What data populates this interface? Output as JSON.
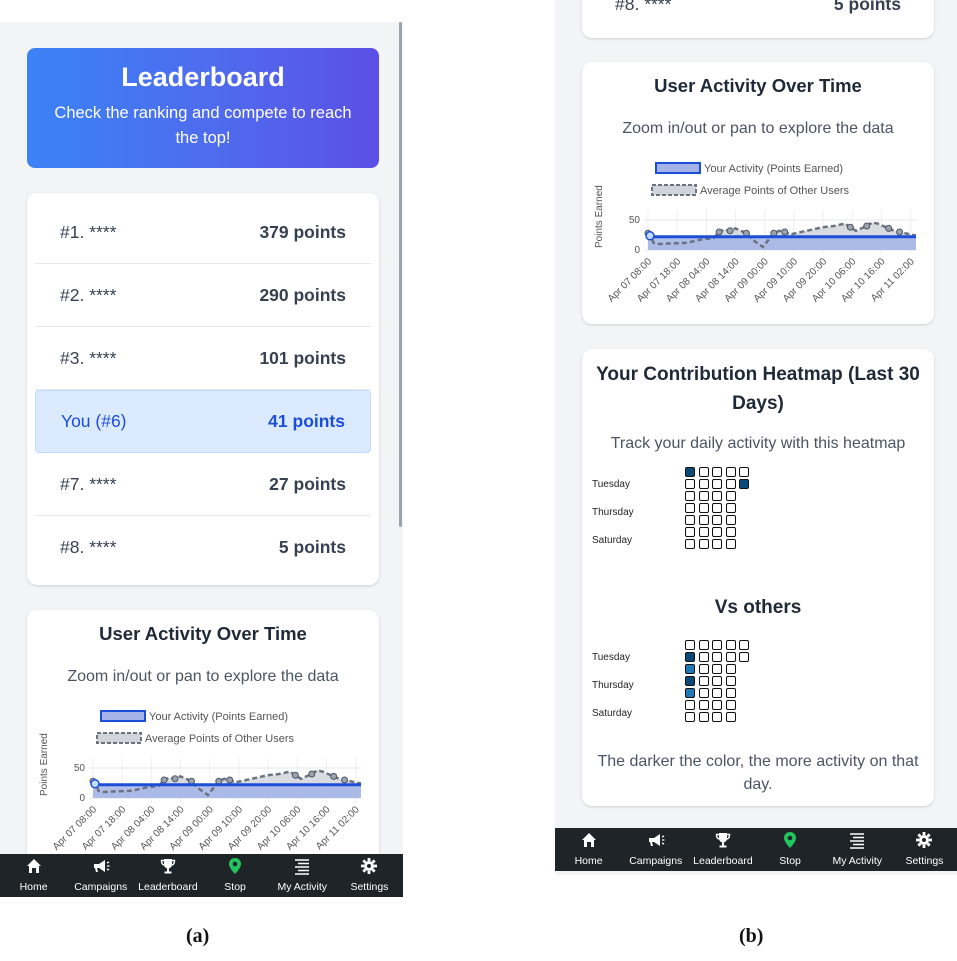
{
  "captions": {
    "a": "(a)",
    "b": "(b)"
  },
  "hero": {
    "title": "Leaderboard",
    "subtitle": "Check the ranking and compete to reach the top!"
  },
  "leaderboard": {
    "rows": [
      {
        "rank": "#1. ****",
        "points": "379 points",
        "is_user": false
      },
      {
        "rank": "#2. ****",
        "points": "290 points",
        "is_user": false
      },
      {
        "rank": "#3. ****",
        "points": "101 points",
        "is_user": false
      },
      {
        "rank": "You (#6)",
        "points": "41 points",
        "is_user": true
      },
      {
        "rank": "#7. ****",
        "points": "27 points",
        "is_user": false
      },
      {
        "rank": "#8. ****",
        "points": "5 points",
        "is_user": false
      }
    ]
  },
  "activity_card": {
    "title": "User Activity Over Time",
    "subtitle": "Zoom in/out or pan to explore the data"
  },
  "chart_data": {
    "type": "line",
    "ylabel": "Points Earned",
    "xlabel": "",
    "ylim": [
      0,
      60
    ],
    "yticks": [
      "0",
      "50"
    ],
    "x_tick_labels": [
      "Apr 07 08:00",
      "Apr 07 18:00",
      "Apr 08 04:00",
      "Apr 08 14:00",
      "Apr 09 00:00",
      "Apr 09 10:00",
      "Apr 09 20:00",
      "Apr 10 06:00",
      "Apr 10 16:00",
      "Apr 11 02:00"
    ],
    "legend_position": "top",
    "series": [
      {
        "name": "Your Activity (Points Earned)",
        "color": "#1d4ed8",
        "fill": "#a5b4e8",
        "x": [
          0,
          98
        ],
        "values": [
          22,
          22
        ]
      },
      {
        "name": "Average Points of Other Users",
        "color": "#6b7280",
        "fill": "#d1d5db",
        "dashed": true,
        "x": [
          0,
          1,
          2,
          4,
          8,
          14,
          16,
          20,
          24,
          26,
          28,
          30,
          32,
          36,
          38,
          42,
          46,
          48,
          50,
          52,
          56,
          60,
          64,
          68,
          70,
          72,
          74,
          76,
          80,
          82,
          84,
          86,
          88,
          90,
          92,
          94,
          96,
          98
        ],
        "values": [
          28,
          25,
          12,
          10,
          11,
          12,
          14,
          18,
          20,
          30,
          34,
          32,
          36,
          28,
          18,
          5,
          28,
          32,
          30,
          26,
          30,
          34,
          38,
          40,
          42,
          44,
          38,
          32,
          40,
          46,
          44,
          40,
          36,
          32,
          30,
          28,
          26,
          24
        ]
      }
    ]
  },
  "heatmap_card": {
    "title": "Your Contribution Heatmap (Last 30 Days)",
    "subtitle": "Track your daily activity with this heatmap",
    "day_labels": [
      "Tuesday",
      "Thursday",
      "Saturday"
    ],
    "vs_title": "Vs others",
    "note": "The darker the color, the more activity on that day."
  },
  "heatmap_data": {
    "yours": {
      "columns": [
        [
          2,
          0,
          0,
          0,
          0,
          0,
          0
        ],
        [
          0,
          0,
          0,
          0,
          0,
          0,
          0
        ],
        [
          0,
          0,
          0,
          0,
          0,
          0,
          0
        ],
        [
          0,
          0,
          0,
          0,
          0,
          0,
          0
        ],
        [
          0,
          2,
          -1,
          -1,
          -1,
          -1,
          -1
        ]
      ]
    },
    "others": {
      "columns": [
        [
          0,
          2,
          1,
          2,
          1,
          0,
          0
        ],
        [
          0,
          0,
          0,
          0,
          0,
          0,
          0
        ],
        [
          0,
          0,
          0,
          0,
          0,
          0,
          0
        ],
        [
          0,
          0,
          0,
          0,
          0,
          0,
          0
        ],
        [
          0,
          0,
          -1,
          -1,
          -1,
          -1,
          -1
        ]
      ]
    },
    "level_colors": [
      "#ffffff",
      "#e0f2f1",
      "#0b4a78"
    ]
  },
  "navbar": {
    "items": [
      {
        "label": "Home",
        "icon": "home-icon"
      },
      {
        "label": "Campaigns",
        "icon": "megaphone-icon"
      },
      {
        "label": "Leaderboard",
        "icon": "trophy-icon"
      },
      {
        "label": "Stop",
        "icon": "map-pin-icon",
        "accent": "#22c55e"
      },
      {
        "label": "My Activity",
        "icon": "list-icon"
      },
      {
        "label": "Settings",
        "icon": "gear-icon"
      }
    ]
  },
  "partial_top_row": {
    "rank": "#8. ****",
    "points": "5 points"
  }
}
